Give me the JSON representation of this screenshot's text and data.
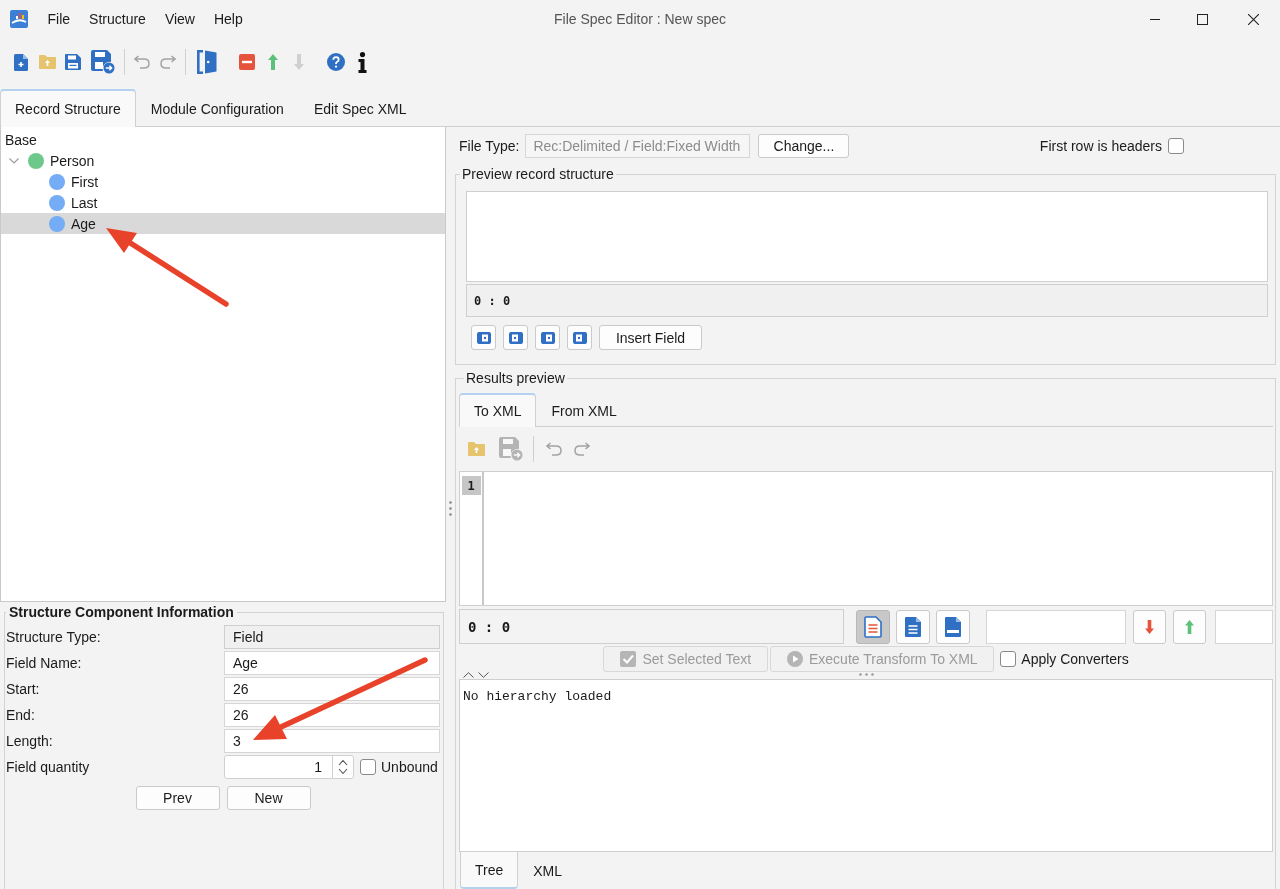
{
  "window": {
    "title": "File Spec Editor : New spec"
  },
  "menu": [
    "File",
    "Structure",
    "View",
    "Help"
  ],
  "toolbar": [
    {
      "disabled": false
    },
    {
      "disabled": false
    },
    {
      "disabled": false
    },
    {
      "disabled": false
    },
    {
      "disabled": true
    },
    {
      "disabled": true
    },
    {
      "disabled": false
    },
    {
      "disabled": false
    },
    {
      "disabled": false
    },
    {
      "disabled": true
    },
    {
      "disabled": false
    },
    {
      "disabled": false
    }
  ],
  "tabs": [
    {
      "label": "Record Structure",
      "selected": true
    },
    {
      "label": "Module Configuration",
      "selected": false
    },
    {
      "label": "Edit Spec XML",
      "selected": false
    }
  ],
  "tree": {
    "root": "Base",
    "items": [
      {
        "label": "Person",
        "color": "#6ec88c",
        "expanded": true,
        "selected": false,
        "children": [
          {
            "label": "First",
            "color": "#74acf5",
            "selected": false
          },
          {
            "label": "Last",
            "color": "#74acf5",
            "selected": false
          },
          {
            "label": "Age",
            "color": "#74acf5",
            "selected": true
          }
        ]
      }
    ]
  },
  "component_info": {
    "title": "Structure Component Information",
    "fields": [
      {
        "label": "Structure Type:",
        "value": "Field",
        "kind": "readonly"
      },
      {
        "label": "Field Name:",
        "value": "Age",
        "kind": "text"
      },
      {
        "label": "Start:",
        "value": "26",
        "kind": "text"
      },
      {
        "label": "End:",
        "value": "26",
        "kind": "text"
      },
      {
        "label": "Length:",
        "value": "3",
        "kind": "text"
      },
      {
        "label": "Field quantity",
        "value": "1",
        "kind": "spinner"
      }
    ],
    "unbound": {
      "label": "Unbound",
      "checked": false
    },
    "buttons": [
      "Prev",
      "New"
    ]
  },
  "file_type": {
    "label": "File Type:",
    "value": "Rec:Delimited / Field:Fixed Width",
    "disabled": true,
    "button": "Change..."
  },
  "first_row_headers": {
    "label": "First row is headers",
    "checked": false
  },
  "preview": {
    "title": "Preview record structure",
    "position": "0 : 0",
    "insert_button": "Insert Field"
  },
  "results": {
    "title": "Results preview",
    "tabs": [
      {
        "label": "To XML",
        "selected": true
      },
      {
        "label": "From XML",
        "selected": false
      }
    ],
    "toolbar": [
      {
        "disabled": false
      },
      {
        "disabled": true
      },
      {
        "disabled": true
      },
      {
        "disabled": true
      }
    ],
    "line_numbers": [
      "1"
    ],
    "position": "0 : 0",
    "view_buttons": [
      {
        "selected": true
      },
      {
        "selected": false
      },
      {
        "selected": false
      }
    ],
    "actions": [
      {
        "label": "Set Selected Text",
        "disabled": true
      },
      {
        "label": "Execute Transform To XML",
        "disabled": true
      }
    ],
    "apply_converters": {
      "label": "Apply Converters",
      "checked": false
    },
    "output": "No hierarchy loaded",
    "bottom_tabs": [
      {
        "label": "Tree",
        "selected": true
      },
      {
        "label": "XML",
        "selected": false
      }
    ]
  }
}
